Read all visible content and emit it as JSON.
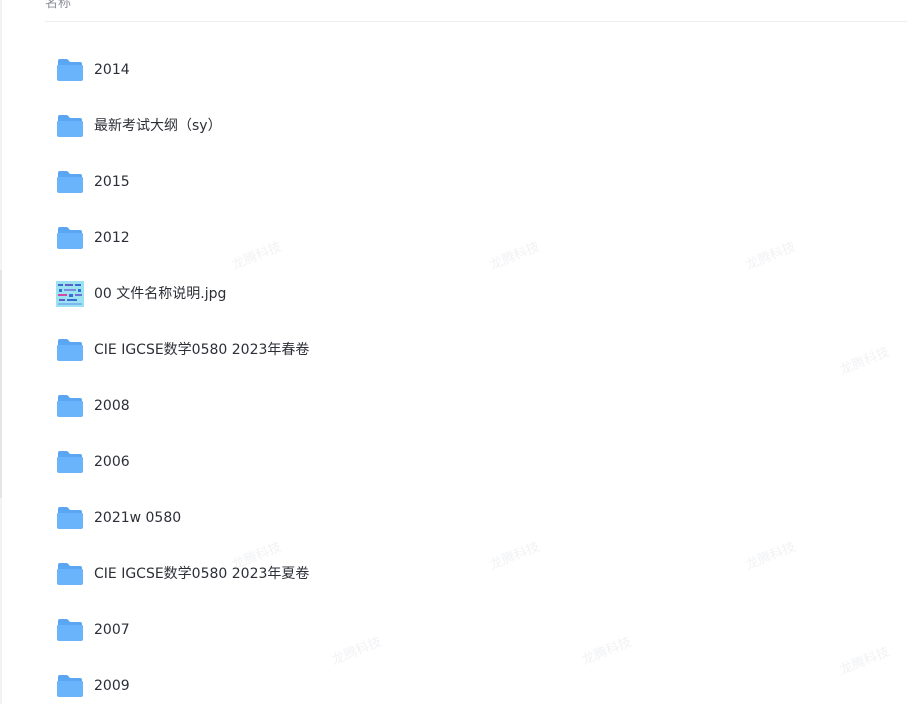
{
  "header": {
    "column_name": "名称"
  },
  "watermark_text": "龙腾科技",
  "colors": {
    "folder": "#69b4fb",
    "folder_tab": "#5aa6f2",
    "text": "#2c2f36",
    "header_text": "#8c8f96"
  },
  "files": [
    {
      "name": "2014",
      "type": "folder-icon"
    },
    {
      "name": "最新考试大纲（sy）",
      "type": "folder-icon"
    },
    {
      "name": "2015",
      "type": "folder-icon"
    },
    {
      "name": "2012",
      "type": "folder-icon"
    },
    {
      "name": "00 文件名称说明.jpg",
      "type": "image-thumbnail-icon"
    },
    {
      "name": "CIE IGCSE数学0580 2023年春卷",
      "type": "folder-icon"
    },
    {
      "name": "2008",
      "type": "folder-icon"
    },
    {
      "name": "2006",
      "type": "folder-icon"
    },
    {
      "name": "2021w 0580",
      "type": "folder-icon"
    },
    {
      "name": "CIE IGCSE数学0580 2023年夏卷",
      "type": "folder-icon"
    },
    {
      "name": "2007",
      "type": "folder-icon"
    },
    {
      "name": "2009",
      "type": "folder-icon"
    }
  ]
}
